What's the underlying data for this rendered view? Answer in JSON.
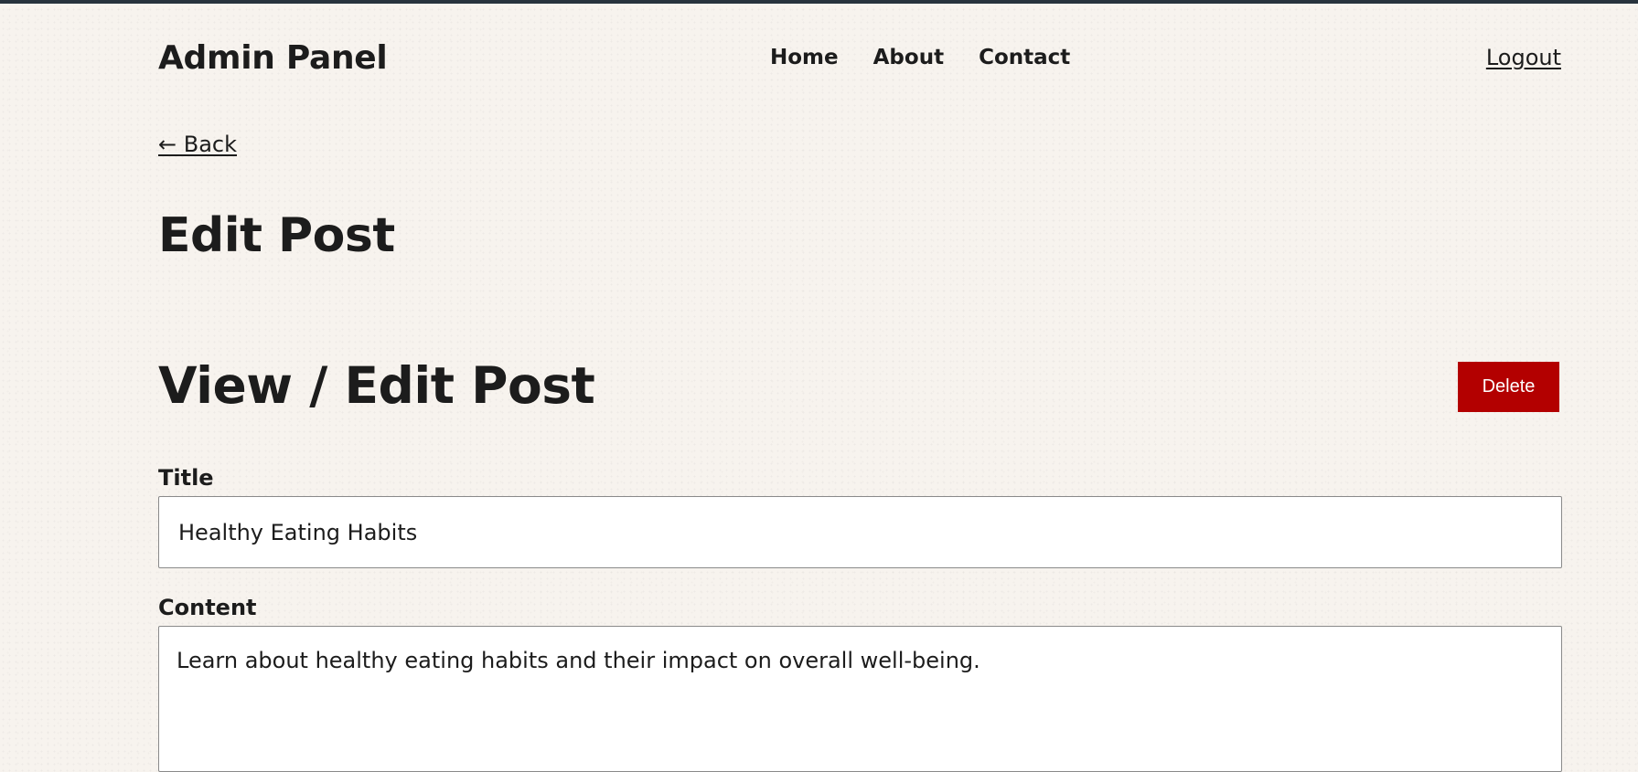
{
  "header": {
    "brand": "Admin Panel",
    "nav": [
      "Home",
      "About",
      "Contact"
    ],
    "logout_label": "Logout"
  },
  "back_label": "← Back",
  "page_title": "Edit Post",
  "section_title": "View / Edit Post",
  "delete_label": "Delete",
  "form": {
    "title_label": "Title",
    "title_value": "Healthy Eating Habits",
    "content_label": "Content",
    "content_value": "Learn about healthy eating habits and their impact on overall well-being."
  },
  "colors": {
    "background": "#f7f3ee",
    "top_bar": "#27333d",
    "delete_button": "#b30000",
    "text": "#1c1c1c"
  }
}
